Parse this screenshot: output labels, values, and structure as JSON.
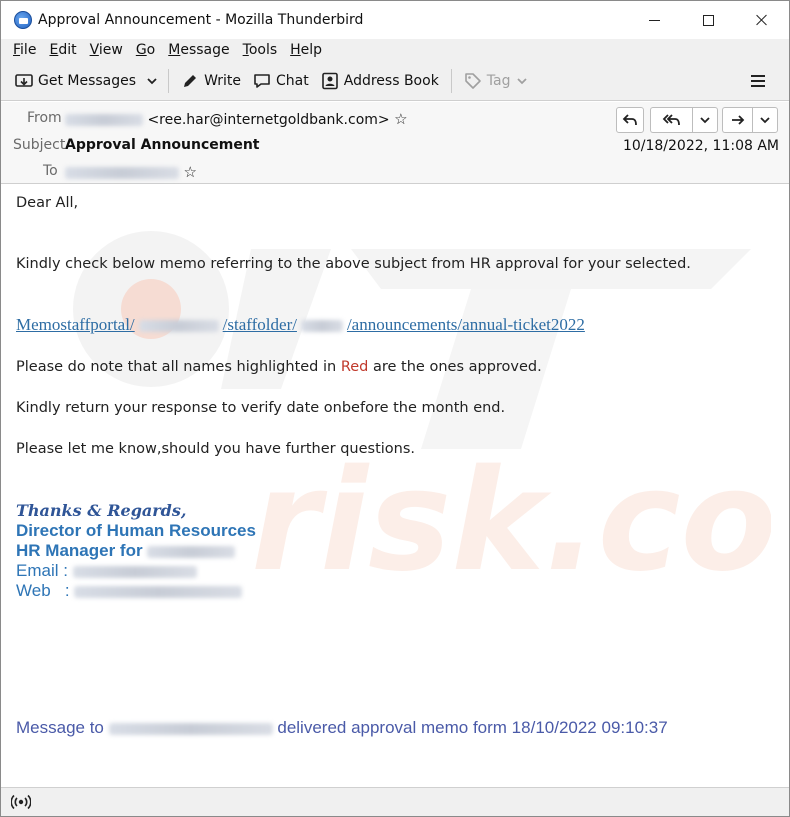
{
  "window": {
    "title": "Approval Announcement - Mozilla Thunderbird",
    "app_icon": "thunderbird-icon",
    "controls": [
      "minimize-icon",
      "maximize-icon",
      "close-icon"
    ]
  },
  "menu": {
    "items": [
      {
        "first": "F",
        "rest": "ile"
      },
      {
        "first": "E",
        "rest": "dit"
      },
      {
        "first": "V",
        "rest": "iew"
      },
      {
        "first": "G",
        "rest": "o"
      },
      {
        "first": "M",
        "rest": "essage"
      },
      {
        "first": "T",
        "rest": "ools"
      },
      {
        "first": "H",
        "rest": "elp"
      }
    ]
  },
  "toolbar": {
    "get_messages": "Get Messages",
    "write": "Write",
    "chat": "Chat",
    "address_book": "Address Book",
    "tag": "Tag"
  },
  "header": {
    "from_label": "From",
    "from_email": "<ree.har@internetgoldbank.com>",
    "subject_label": "Subject",
    "subject": "Approval Announcement",
    "to_label": "To",
    "date": "10/18/2022, 11:08 AM"
  },
  "body": {
    "greeting": "Dear All,",
    "line1": "Kindly check below memo referring to the above subject from HR approval for your selected.",
    "link_part1": "Memostaffportal/",
    "link_part2": "/staffolder/",
    "link_part3": "/announcements/annual-ticket2022",
    "line2_pre": "Please do note that all names highlighted in",
    "line2_red": "Red",
    "line2_post": "are the ones approved.",
    "line3": "Kindly return your response to verify date onbefore the month end.",
    "line4": "Please let me know,should you have further questions.",
    "sig_thanks": "Thanks & Regards,",
    "sig_title": "Director of Human Resources",
    "sig_hr": "HR Manager for",
    "sig_email": "Email :",
    "sig_web": "Web   :",
    "footer_pre": "Message to",
    "footer_post": "delivered approval memo form 18/10/2022 09:10:37",
    "watermark_text": "risk.com"
  },
  "colors": {
    "link": "#2e6da4",
    "red_highlight": "#c0392b",
    "signature": "#2e75b6",
    "footer": "#4a5aa8"
  }
}
